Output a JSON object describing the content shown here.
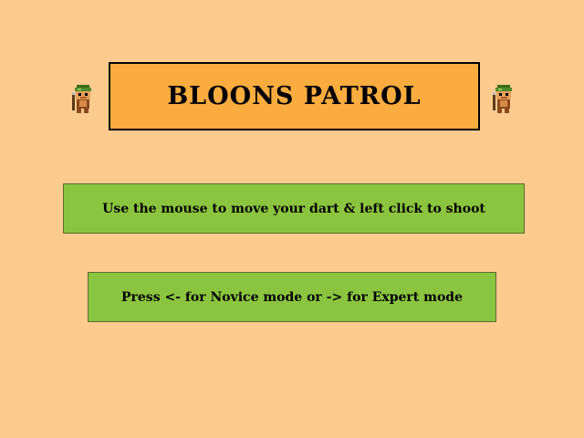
{
  "colors": {
    "background": "#fecb8e",
    "title_box": "#fbac3e",
    "info_box": "#8bc53f"
  },
  "title": {
    "text": "BLOONS PATROL"
  },
  "instructions": {
    "mouse": "Use the mouse to move your dart & left click to shoot",
    "mode": "Press <- for Novice mode or -> for Expert mode"
  },
  "sprites": {
    "left": "dart-monkey-icon",
    "right": "dart-monkey-icon"
  }
}
